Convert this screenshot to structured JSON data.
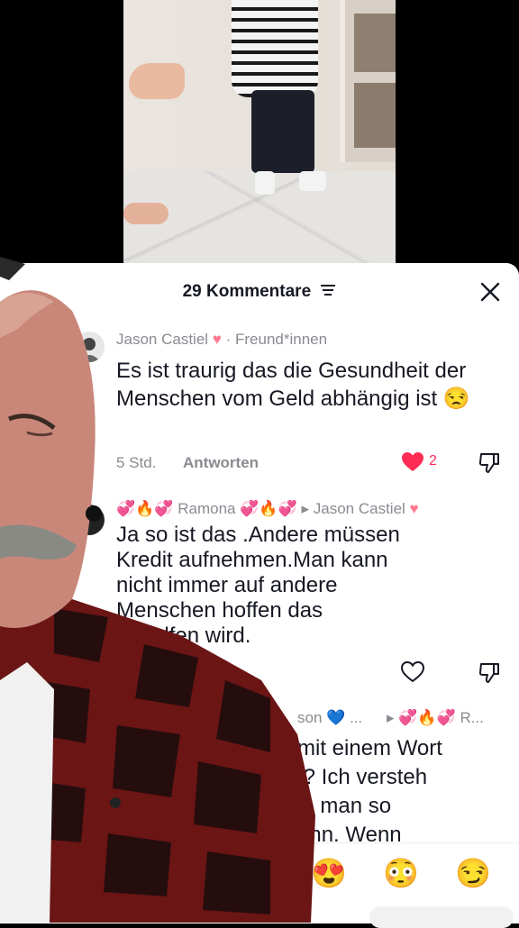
{
  "sheet": {
    "title": "29 Kommentare"
  },
  "comments": [
    {
      "author": "Jason Castiel",
      "author_heart": "♥",
      "tag": "· Freund*innen",
      "text": "Es ist traurig das die Gesundheit der Menschen vom Geld abhängig ist 😒",
      "time": "5 Std.",
      "reply_label": "Antworten",
      "likes": "2",
      "liked": true
    },
    {
      "author": "Ramona",
      "author_decor_left": "💞🔥💞",
      "author_decor_right": "💞🔥💞",
      "reply_to": "▸ Jason Castiel",
      "reply_to_heart": "♥",
      "text_lines": [
        "Ja so ist das .Andere müssen",
        "Kredit aufnehmen.Man kann",
        "nicht immer auf andere",
        "Menschen hoffen das",
        "geholfen wird."
      ]
    },
    {
      "author_partial": "son",
      "author_partial_heart": "💙",
      "author_partial_suffix": "...",
      "reply_to_partial": "▸ 💞🔥💞 R...",
      "text_lines": [
        "mit einem Wort",
        "t? Ich versteh",
        "ie man so",
        "ann. Wenn"
      ]
    }
  ],
  "emoji_bar": {
    "emojis": [
      "😊",
      "😂",
      "😍",
      "😳",
      "😏"
    ]
  },
  "icons": {
    "filter": "filter-icon",
    "close": "close-icon",
    "like": "heart-icon",
    "dislike": "thumbs-down-icon"
  },
  "colors": {
    "like_active": "#fe2c55",
    "meta_text": "#8a8b91",
    "text": "#161823"
  }
}
